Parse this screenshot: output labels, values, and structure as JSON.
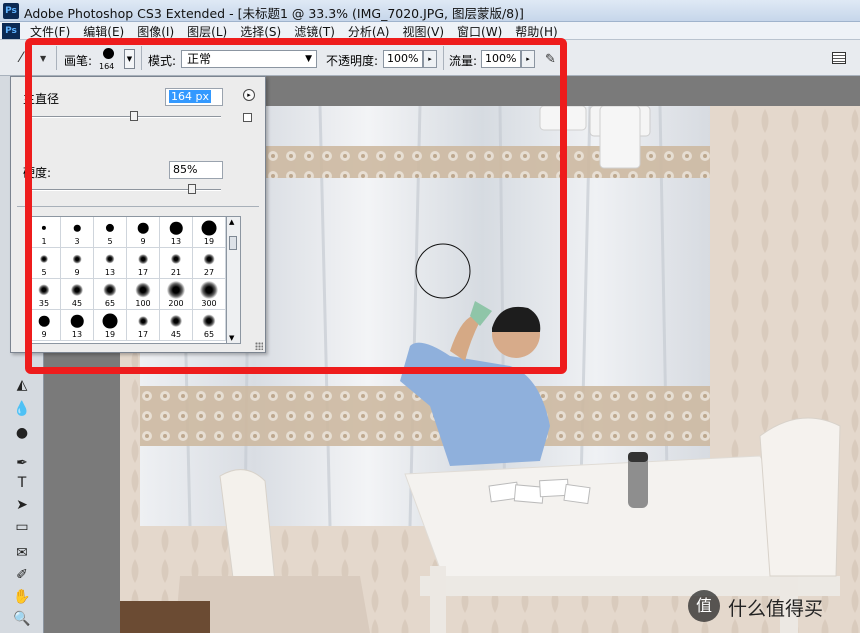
{
  "window": {
    "title": "Adobe Photoshop CS3 Extended - [未标题1 @ 33.3% (IMG_7020.JPG, 图层蒙版/8)]",
    "app_badge": "Ps"
  },
  "menu": [
    "文件(F)",
    "编辑(E)",
    "图像(I)",
    "图层(L)",
    "选择(S)",
    "滤镜(T)",
    "分析(A)",
    "视图(V)",
    "窗口(W)",
    "帮助(H)"
  ],
  "options": {
    "brush_label": "画笔:",
    "brush_size": "164",
    "mode_label": "模式:",
    "mode_value": "正常",
    "opacity_label": "不透明度:",
    "opacity_value": "100%",
    "flow_label": "流量:",
    "flow_value": "100%"
  },
  "brush_panel": {
    "diameter_label": "主直径",
    "diameter_value": "164 px",
    "diameter_fraction": 0.55,
    "hardness_label": "硬度:",
    "hardness_value": "85%",
    "hardness_fraction": 0.85,
    "presets": [
      {
        "label": "1",
        "type": "hard"
      },
      {
        "label": "3",
        "type": "hard"
      },
      {
        "label": "5",
        "type": "hard"
      },
      {
        "label": "9",
        "type": "hard"
      },
      {
        "label": "13",
        "type": "hard"
      },
      {
        "label": "19",
        "type": "hard"
      },
      {
        "label": "5",
        "type": "soft"
      },
      {
        "label": "9",
        "type": "soft"
      },
      {
        "label": "13",
        "type": "soft"
      },
      {
        "label": "17",
        "type": "soft"
      },
      {
        "label": "21",
        "type": "soft"
      },
      {
        "label": "27",
        "type": "soft"
      },
      {
        "label": "35",
        "type": "soft"
      },
      {
        "label": "45",
        "type": "soft"
      },
      {
        "label": "65",
        "type": "soft"
      },
      {
        "label": "100",
        "type": "soft"
      },
      {
        "label": "200",
        "type": "soft"
      },
      {
        "label": "300",
        "type": "soft"
      },
      {
        "label": "9",
        "type": "hard"
      },
      {
        "label": "13",
        "type": "hard"
      },
      {
        "label": "19",
        "type": "hard"
      },
      {
        "label": "17",
        "type": "soft"
      },
      {
        "label": "45",
        "type": "soft"
      },
      {
        "label": "65",
        "type": "soft"
      }
    ]
  },
  "watermark": {
    "badge": "值",
    "text": "什么值得买"
  },
  "colors": {
    "annotation": "#ee1c1c",
    "selection": "#3399ff"
  }
}
